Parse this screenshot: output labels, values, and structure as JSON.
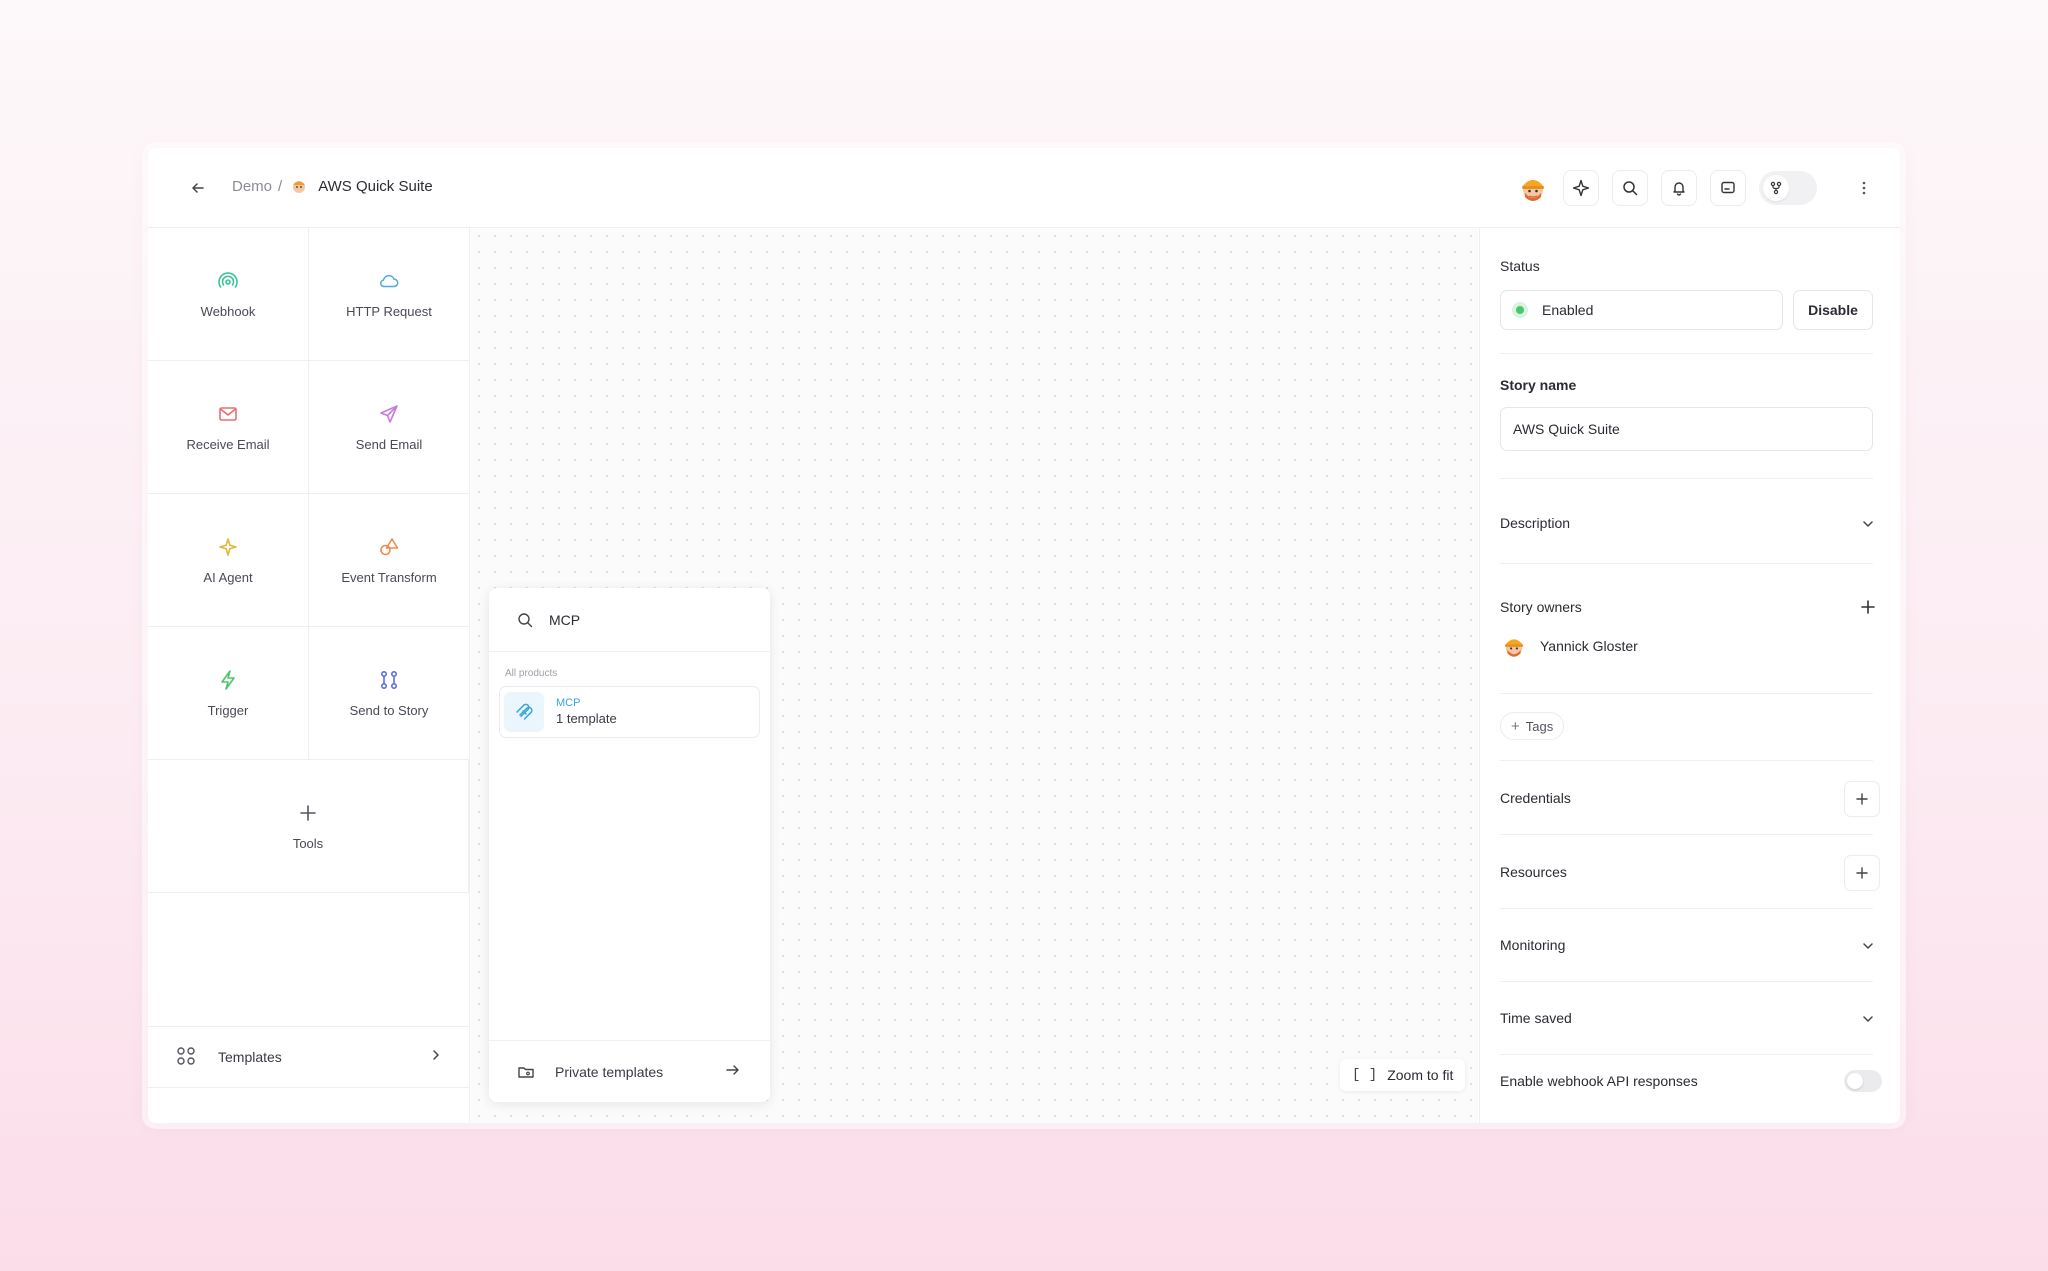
{
  "header": {
    "breadcrumb_parent": "Demo",
    "breadcrumb_sep": "/",
    "story_title": "AWS Quick Suite"
  },
  "actions": [
    {
      "label": "Webhook",
      "icon": "webhook-icon",
      "color": "#3cc49a"
    },
    {
      "label": "HTTP Request",
      "icon": "cloud-icon",
      "color": "#4aa9e0"
    },
    {
      "label": "Receive Email",
      "icon": "mail-icon",
      "color": "#ef6b6b"
    },
    {
      "label": "Send Email",
      "icon": "send-icon",
      "color": "#c77be0"
    },
    {
      "label": "AI Agent",
      "icon": "sparkle-icon",
      "color": "#e8b43a"
    },
    {
      "label": "Event Transform",
      "icon": "shapes-icon",
      "color": "#f08a4b"
    },
    {
      "label": "Trigger",
      "icon": "bolt-icon",
      "color": "#4cc56c"
    },
    {
      "label": "Send to Story",
      "icon": "branch-icon",
      "color": "#5a6ee0"
    },
    {
      "label": "Tools",
      "icon": "plus-icon",
      "color": "#55555f"
    }
  ],
  "templates_label": "Templates",
  "canvas": {
    "zoom_icon": "[ ]",
    "zoom_label": "Zoom to fit"
  },
  "search_popup": {
    "query": "MCP",
    "section_label": "All products",
    "result": {
      "name": "MCP",
      "subtitle": "1 template"
    },
    "footer_label": "Private templates"
  },
  "right_panel": {
    "status_label": "Status",
    "status_value": "Enabled",
    "disable_label": "Disable",
    "story_name_label": "Story name",
    "story_name_value": "AWS Quick Suite",
    "description_label": "Description",
    "owners_label": "Story owners",
    "owner_name": "Yannick Gloster",
    "tags_label": "Tags",
    "credentials_label": "Credentials",
    "resources_label": "Resources",
    "monitoring_label": "Monitoring",
    "time_saved_label": "Time saved",
    "webhook_api_label": "Enable webhook API responses",
    "webhook_api_enabled": false
  },
  "colors": {
    "status_green": "#4cc56c",
    "accent_blue": "#3aa6d6"
  }
}
